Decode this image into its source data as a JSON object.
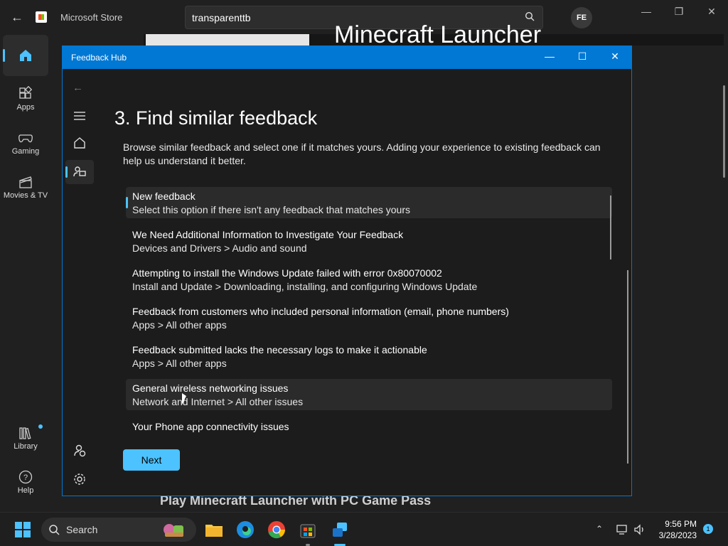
{
  "store": {
    "title": "Microsoft Store",
    "search_value": "transparenttb",
    "avatar_initials": "FE",
    "hero_title": "Minecraft Launcher",
    "bottom_text": "Play Minecraft Launcher with PC Game Pass",
    "sidebar": [
      {
        "label": "",
        "icon": "home-icon"
      },
      {
        "label": "Apps",
        "icon": "apps-icon"
      },
      {
        "label": "Gaming",
        "icon": "gamepad-icon"
      },
      {
        "label": "Movies & TV",
        "icon": "clapper-icon"
      },
      {
        "label": "Library",
        "icon": "library-icon"
      },
      {
        "label": "Help",
        "icon": "help-icon"
      }
    ]
  },
  "feedback_hub": {
    "title": "Feedback Hub",
    "heading": "3. Find similar feedback",
    "description": "Browse similar feedback and select one if it matches yours. Adding your experience to existing feedback can help us understand it better.",
    "next_label": "Next",
    "items": [
      {
        "title": "New feedback",
        "subtitle": "Select this option if there isn't any feedback that matches yours"
      },
      {
        "title": "We Need Additional Information to Investigate Your Feedback",
        "subtitle": "Devices and Drivers > Audio and sound"
      },
      {
        "title": "Attempting to install the Windows Update failed with error 0x80070002",
        "subtitle": "Install and Update > Downloading, installing, and configuring Windows Update"
      },
      {
        "title": "Feedback from customers who included personal information (email, phone numbers)",
        "subtitle": "Apps > All other apps"
      },
      {
        "title": "Feedback submitted lacks the necessary logs to make it actionable",
        "subtitle": "Apps > All other apps"
      },
      {
        "title": "General wireless networking issues",
        "subtitle": "Network and Internet > All other issues"
      },
      {
        "title": "Your Phone app connectivity issues",
        "subtitle": ""
      }
    ]
  },
  "taskbar": {
    "search_label": "Search",
    "time": "9:56 PM",
    "date": "3/28/2023",
    "notification_count": "1"
  },
  "colors": {
    "accent": "#4cc2ff",
    "titlebar": "#0078d4"
  }
}
